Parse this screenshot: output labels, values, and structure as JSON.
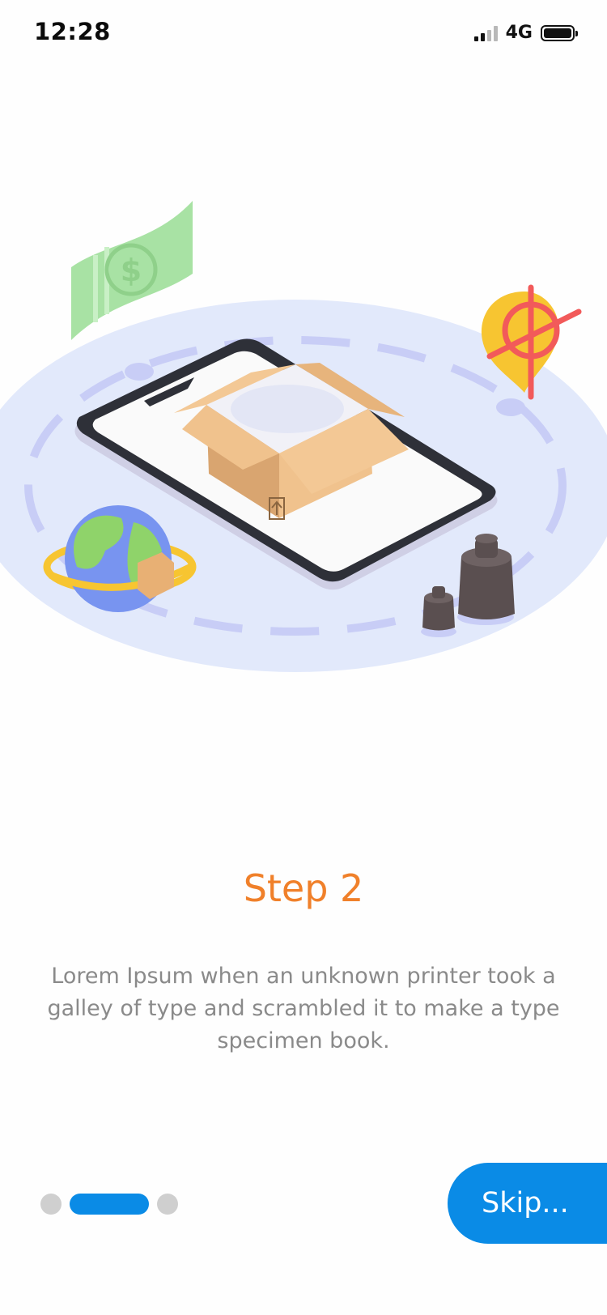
{
  "status_bar": {
    "time": "12:28",
    "network": "4G"
  },
  "onboarding": {
    "title": "Step 2",
    "description": "Lorem Ipsum when an unknown printer took a galley of type and scrambled it to make a type specimen book.",
    "page_index": 2,
    "page_count": 3
  },
  "actions": {
    "skip_label": "Skip..."
  },
  "colors": {
    "accent_orange": "#f0802a",
    "primary_blue": "#0a8be6",
    "inactive_dot": "#cfcfcf",
    "text_gray": "#8a8a8a"
  }
}
